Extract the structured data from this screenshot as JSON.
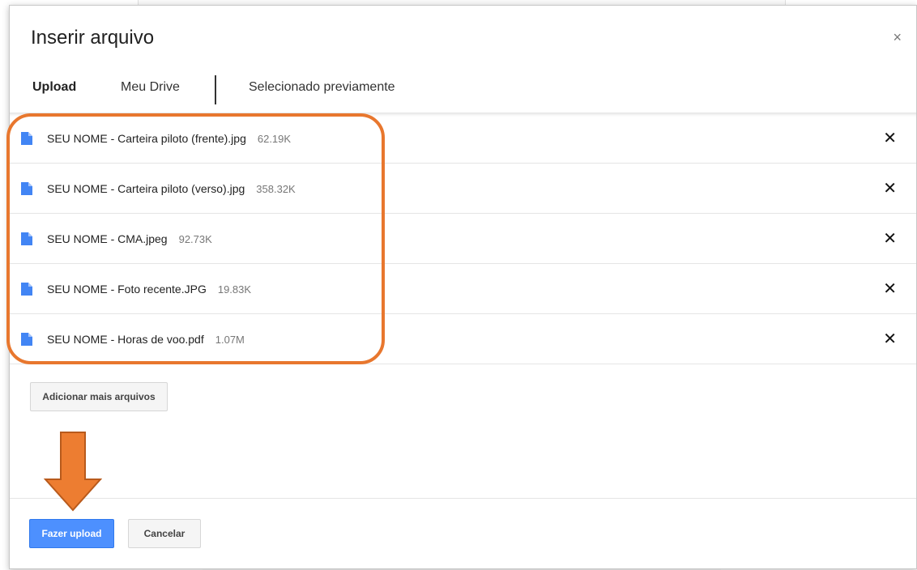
{
  "dialog": {
    "title": "Inserir arquivo",
    "close_label": "×"
  },
  "tabs": [
    {
      "label": "Upload",
      "active": true
    },
    {
      "label": "Meu Drive",
      "active": false
    },
    {
      "label": "Selecionado previamente",
      "active": false
    }
  ],
  "files": [
    {
      "name": "SEU NOME - Carteira piloto (frente).jpg",
      "size": "62.19K",
      "icon": "file-icon"
    },
    {
      "name": "SEU NOME - Carteira piloto (verso).jpg",
      "size": "358.32K",
      "icon": "file-icon"
    },
    {
      "name": "SEU NOME - CMA.jpeg",
      "size": "92.73K",
      "icon": "file-icon"
    },
    {
      "name": "SEU NOME - Foto recente.JPG",
      "size": "19.83K",
      "icon": "file-icon"
    },
    {
      "name": "SEU NOME - Horas de voo.pdf",
      "size": "1.07M",
      "icon": "file-icon"
    }
  ],
  "remove_label": "✕",
  "buttons": {
    "add_more": "Adicionar mais arquivos",
    "upload": "Fazer upload",
    "cancel": "Cancelar"
  },
  "colors": {
    "accent_blue": "#4d90fe",
    "annotation_orange": "#e8772e"
  }
}
